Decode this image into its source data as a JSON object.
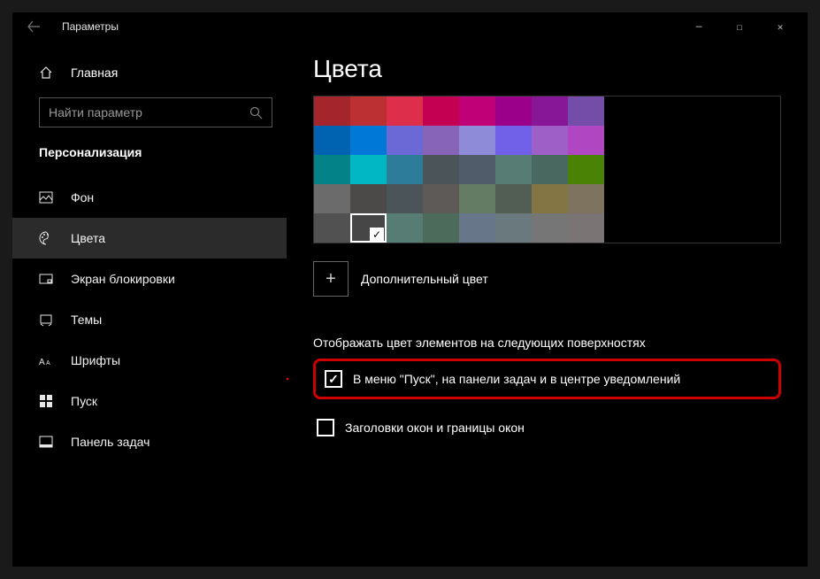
{
  "titlebar": {
    "title": "Параметры"
  },
  "home": {
    "label": "Главная"
  },
  "search": {
    "placeholder": "Найти параметр"
  },
  "category": {
    "label": "Персонализация"
  },
  "nav": [
    {
      "id": "background",
      "label": "Фон"
    },
    {
      "id": "colors",
      "label": "Цвета"
    },
    {
      "id": "lockscreen",
      "label": "Экран блокировки"
    },
    {
      "id": "themes",
      "label": "Темы"
    },
    {
      "id": "fonts",
      "label": "Шрифты"
    },
    {
      "id": "start",
      "label": "Пуск"
    },
    {
      "id": "taskbar",
      "label": "Панель задач"
    }
  ],
  "page": {
    "title": "Цвета"
  },
  "palette": [
    [
      "#a4262c",
      "#bc2f32",
      "#dd2f4c",
      "#c30052",
      "#bf0077",
      "#9a0089",
      "#881798",
      "#744da9"
    ],
    [
      "#0063b1",
      "#0078d7",
      "#6b69d6",
      "#8764b8",
      "#8e8cd8",
      "#7160e8",
      "#9e5fc7",
      "#b146c2"
    ],
    [
      "#038387",
      "#00b7c3",
      "#2d7d9a",
      "#4a5459",
      "#515c6b",
      "#567c73",
      "#486860",
      "#498205"
    ],
    [
      "#6b6b6b",
      "#4c4a48",
      "#4a5459",
      "#5d5a58",
      "#647c64",
      "#525e54",
      "#847545",
      "#7e735f"
    ],
    [
      "#515151",
      "#464646",
      "#567c73",
      "#4c6b5a",
      "#68768a",
      "#69797e",
      "#767676",
      "#7a7574"
    ]
  ],
  "selectedSwatch": "4-1",
  "customColor": {
    "label": "Дополнительный цвет"
  },
  "section": {
    "label": "Отображать цвет элементов на следующих поверхностях"
  },
  "checkbox1": {
    "label": "В меню \"Пуск\", на панели задач и в центре уведомлений",
    "checked": true
  },
  "checkbox2": {
    "label": "Заголовки окон и границы окон",
    "checked": false
  }
}
